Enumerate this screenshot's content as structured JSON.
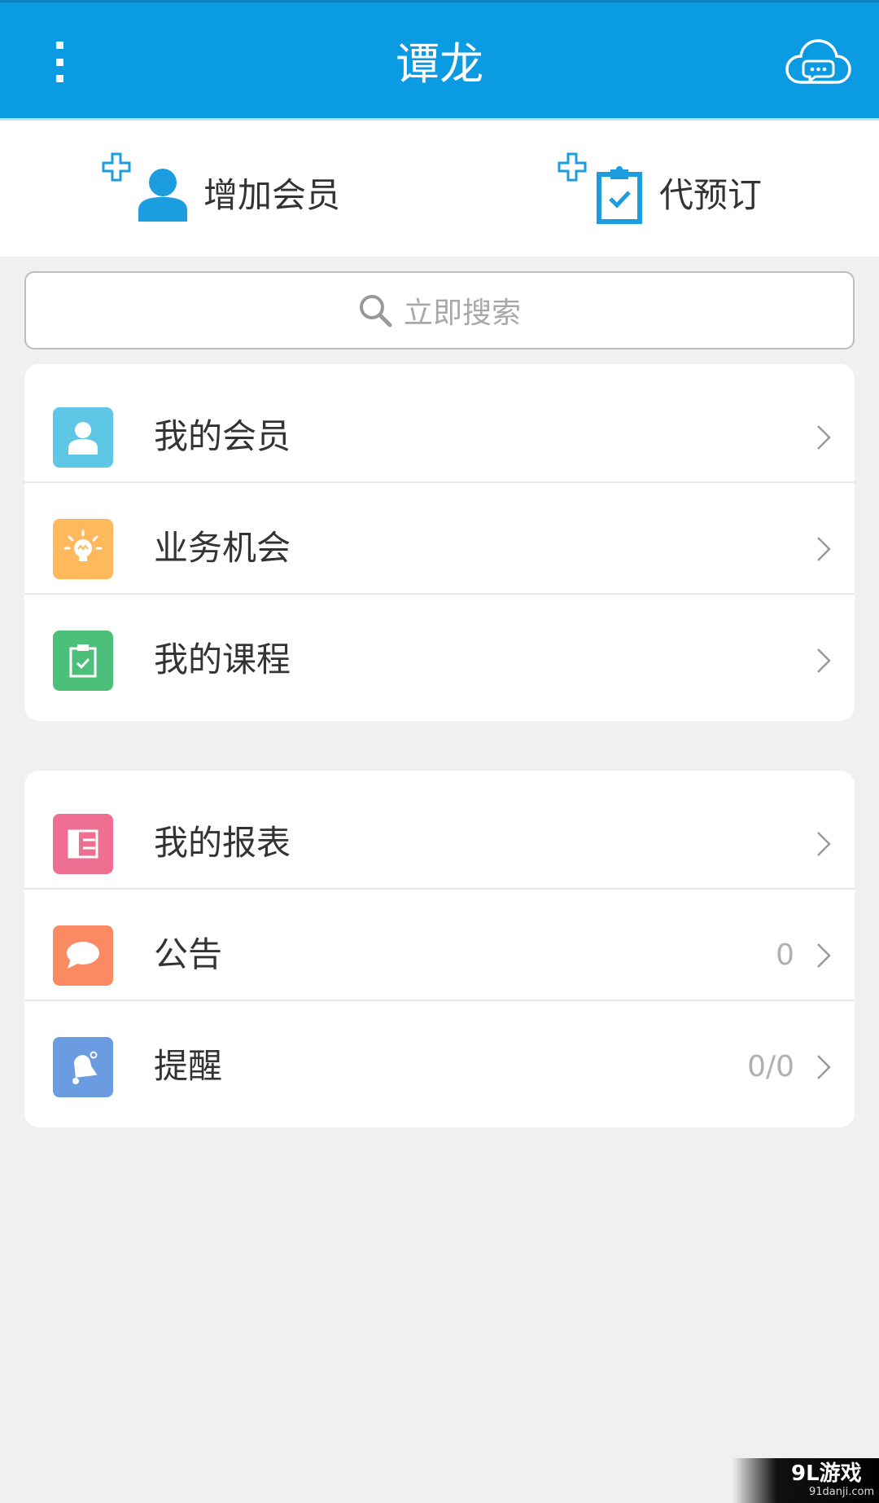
{
  "header": {
    "title": "谭龙",
    "menu_icon": "more-vert-icon",
    "chat_icon": "cloud-chat-icon"
  },
  "quick_actions": {
    "add_member": {
      "label": "增加会员",
      "icon": "add-person-icon"
    },
    "booking": {
      "label": "代预订",
      "icon": "add-clipboard-icon"
    }
  },
  "search": {
    "placeholder": "立即搜索",
    "icon": "search-icon"
  },
  "menu": {
    "group1": [
      {
        "label": "我的会员",
        "icon": "person-icon",
        "color": "#5ec7e6"
      },
      {
        "label": "业务机会",
        "icon": "lightbulb-icon",
        "color": "#ffb85c"
      },
      {
        "label": "我的课程",
        "icon": "clipboard-check-icon",
        "color": "#4cc07a"
      }
    ],
    "group2": [
      {
        "label": "我的报表",
        "icon": "report-icon",
        "color": "#ef6f92"
      },
      {
        "label": "公告",
        "icon": "chat-bubble-icon",
        "color": "#fb8a62",
        "count": "0"
      },
      {
        "label": "提醒",
        "icon": "bell-icon",
        "color": "#6b9be0",
        "count": "0/0"
      }
    ]
  },
  "colors": {
    "header": "#0b9be2",
    "accent": "#1b9ddf"
  },
  "watermark": {
    "main": "9L游戏",
    "sub": "91danji.com"
  }
}
